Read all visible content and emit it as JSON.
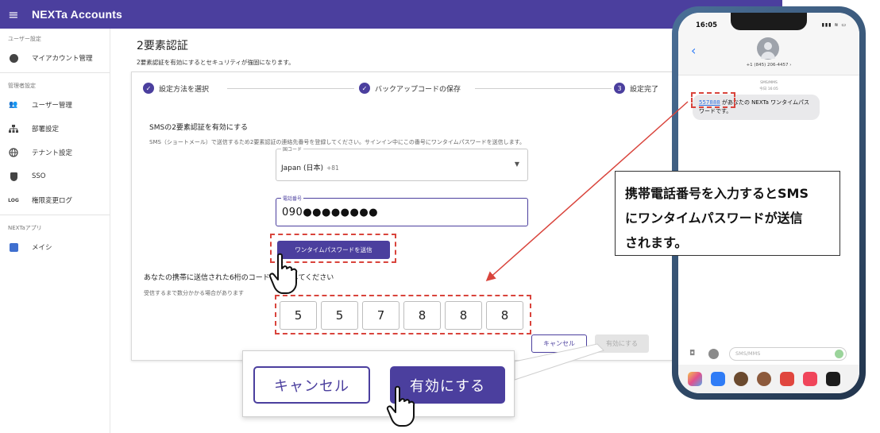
{
  "appbar": {
    "title": "NEXTa Accounts",
    "menu_icon": "menu-icon"
  },
  "sidebar": {
    "sections": [
      {
        "label": "ユーザー設定",
        "items": [
          {
            "label": "マイアカウント管理",
            "icon": "account-circle-icon"
          }
        ]
      },
      {
        "label": "管理者設定",
        "items": [
          {
            "label": "ユーザー管理",
            "icon": "users-icon"
          },
          {
            "label": "部署設定",
            "icon": "org-chart-icon"
          },
          {
            "label": "テナント設定",
            "icon": "globe-icon"
          },
          {
            "label": "SSO",
            "icon": "shield-icon"
          },
          {
            "label": "権限変更ログ",
            "icon": "log-icon"
          }
        ]
      },
      {
        "label": "NEXTaアプリ",
        "items": [
          {
            "label": "メイシ",
            "icon": "app-icon"
          }
        ]
      }
    ],
    "log_icon_text": "LOG"
  },
  "main": {
    "title": "2要素認証",
    "subtitle": "2要素認証を有効にするとセキュリティが強固になります。",
    "steps": [
      {
        "label": "設定方法を選択",
        "state": "done"
      },
      {
        "label": "バックアップコードの保存",
        "state": "done"
      },
      {
        "label": "設定完了",
        "state": "current",
        "number": "3"
      }
    ],
    "sms_title": "SMSの2要素認証を有効にする",
    "sms_desc": "SMS（ショートメール）で送信するため2要素認証の連絡先番号を登録してください。サインイン中にこの番号にワンタイムパスワードを送信します。",
    "country_field": {
      "label": "国コード",
      "value": "Japan (日本)",
      "code": "+81"
    },
    "phone_field": {
      "label": "電話番号",
      "value": "090●●●●●●●●"
    },
    "otp_button": "ワンタイムパスワードを送信",
    "code_title": "あなたの携帯に送信された6桁のコードを入力してください",
    "code_desc": "受信するまで数分かかる場合があります",
    "code_digits": [
      "5",
      "5",
      "7",
      "8",
      "8",
      "8"
    ],
    "cancel_button": "キャンセル",
    "enable_button": "有効にする",
    "enable_disabled": true
  },
  "zoom": {
    "cancel_label": "キャンセル",
    "enable_label": "有効にする"
  },
  "annotation": {
    "lines": [
      "携帯電話番号を入力するとSMS",
      "にワンタイムパスワードが送信",
      "されます。"
    ]
  },
  "phone": {
    "time": "16:05",
    "status": "▮▮▮ ≋ ▭",
    "back": "‹",
    "number": "+1 (845) 206-4457 ›",
    "meta_line1": "SMS/MMS",
    "meta_line2": "今日 16:05",
    "otp": "557888",
    "message_rest": " があなたの NEXTa ワンタイムパスワードです。",
    "input_placeholder": "SMS/MMS",
    "camera_icon": "camera-icon"
  },
  "colors": {
    "brand": "#4b3f9e",
    "highlight": "#d9443c",
    "link": "#2f6fe0"
  }
}
